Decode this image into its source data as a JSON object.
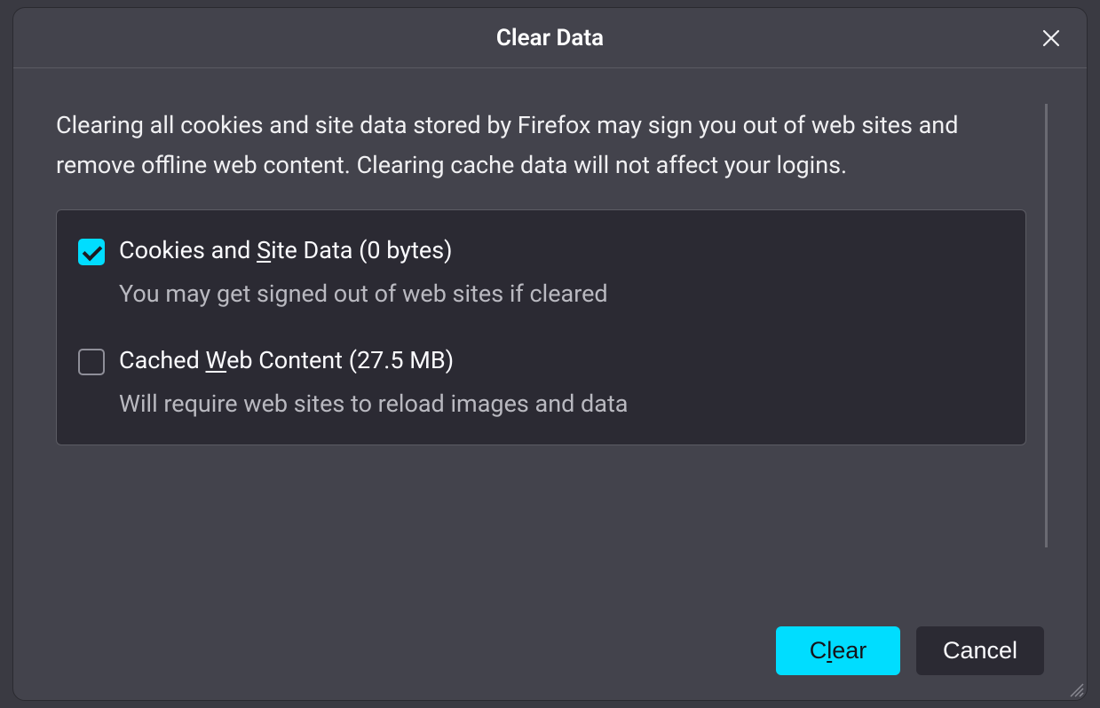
{
  "dialog": {
    "title": "Clear Data",
    "description": "Clearing all cookies and site data stored by Firefox may sign you out of web sites and remove offline web content. Clearing cache data will not affect your logins.",
    "options": [
      {
        "checked": true,
        "label_pre": "Cookies and ",
        "label_access": "S",
        "label_post": "ite Data (0 bytes)",
        "sub": "You may get signed out of web sites if cleared"
      },
      {
        "checked": false,
        "label_pre": "Cached ",
        "label_access": "W",
        "label_post": "eb Content (27.5 MB)",
        "sub": "Will require web sites to reload images and data"
      }
    ],
    "buttons": {
      "primary_pre": "C",
      "primary_access": "l",
      "primary_post": "ear",
      "secondary": "Cancel"
    }
  }
}
